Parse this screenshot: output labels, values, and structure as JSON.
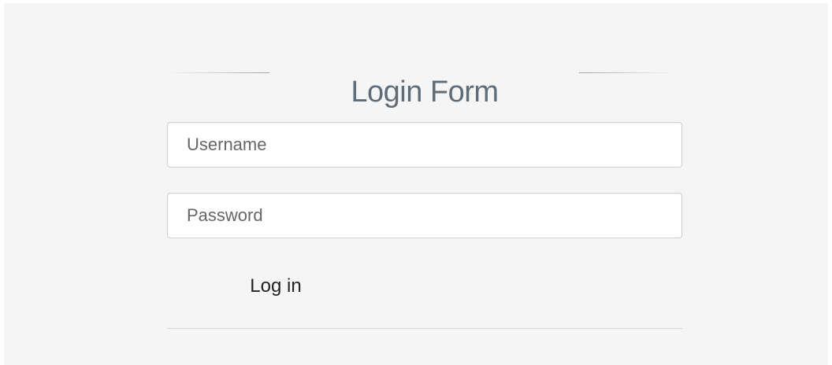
{
  "form": {
    "title": "Login Form",
    "username": {
      "placeholder": "Username",
      "value": ""
    },
    "password": {
      "placeholder": "Password",
      "value": ""
    },
    "submit_label": "Log in"
  },
  "colors": {
    "background": "#f5f5f5",
    "title": "#5f6c79",
    "input_border": "#cfcfcf",
    "divider": "#d6d6d6"
  }
}
